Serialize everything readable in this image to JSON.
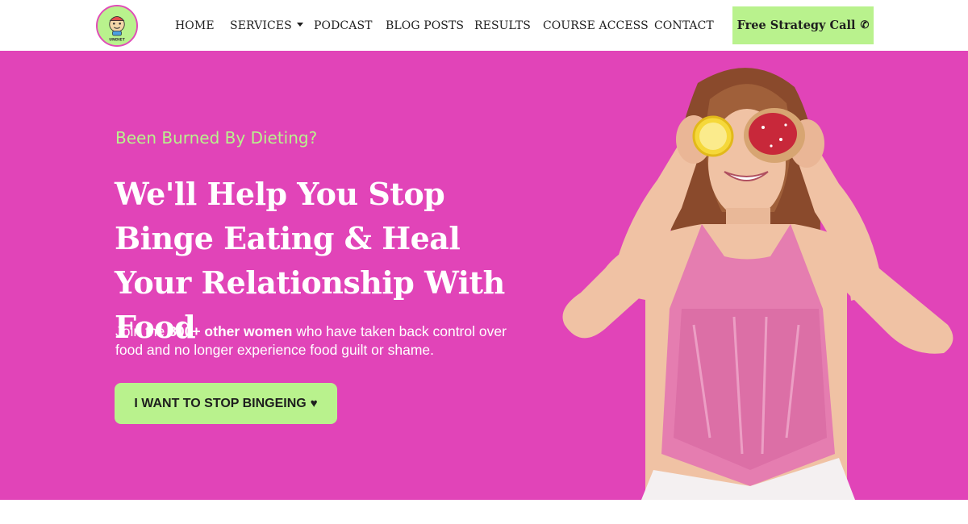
{
  "nav": {
    "items": [
      {
        "label": "HOME"
      },
      {
        "label": "SERVICES"
      },
      {
        "label": "PODCAST"
      },
      {
        "label": "BLOG POSTS"
      },
      {
        "label": "RESULTS"
      },
      {
        "label": "COURSE ACCESS"
      },
      {
        "label": "CONTACT"
      }
    ],
    "cta_label": "Free Strategy Call",
    "cta_icon": "phone-icon"
  },
  "hero": {
    "eyebrow": "Been Burned By Dieting?",
    "headline": "We'll Help You Stop Binge Eating & Heal Your Relationship With Food",
    "sub_prefix": "Join the ",
    "sub_bold": "800+ other women",
    "sub_suffix": " who have taken back control over food and no longer experience food guilt or shame.",
    "cta_label": "I WANT TO STOP BINGEING",
    "cta_icon": "heart-icon"
  },
  "colors": {
    "accent_green": "#b9f28d",
    "hero_pink": "#e144b8",
    "text_dark": "#1e1e1e"
  }
}
